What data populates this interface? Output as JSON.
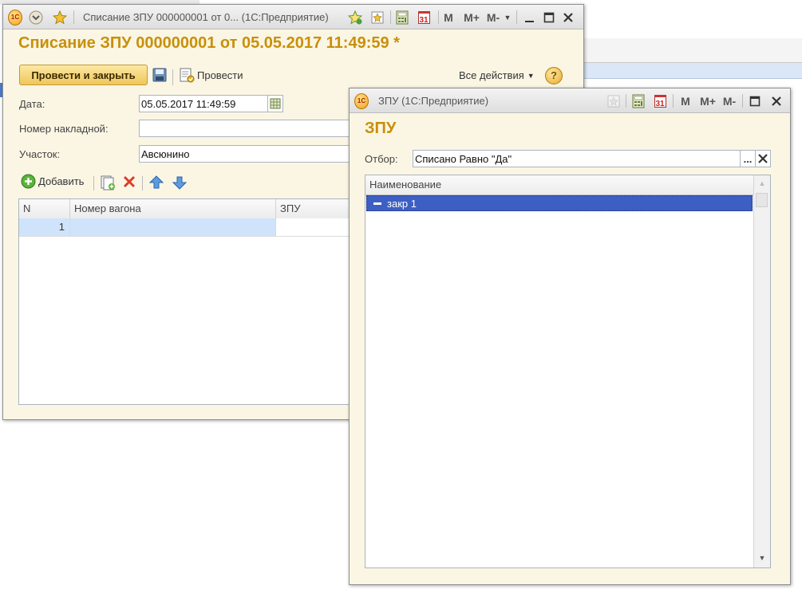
{
  "doc_window": {
    "title": "Списание ЗПУ 000000001 от 0... (1С:Предприятие)",
    "form_title": "Списание ЗПУ 000000001 от 05.05.2017 11:49:59 *",
    "post_close_label": "Провести и закрыть",
    "post_label": "Провести",
    "all_actions_label": "Все действия",
    "help_label": "?",
    "date_label": "Дата:",
    "date_value": "05.05.2017 11:49:59",
    "invoice_label": "Номер накладной:",
    "invoice_value": "",
    "section_label": "Участок:",
    "section_value": "Авсюнино",
    "add_label": "Добавить",
    "columns": [
      "N",
      "Номер вагона",
      "ЗПУ"
    ],
    "rows": [
      {
        "n": "1",
        "wagon": "",
        "zpu": ""
      }
    ]
  },
  "choice_window": {
    "title": "ЗПУ (1С:Предприятие)",
    "form_title": "ЗПУ",
    "filter_label": "Отбор:",
    "filter_value": "Списано Равно \"Да\"",
    "filter_more_label": "...",
    "column_name": "Наименование",
    "items": [
      {
        "label": "закр 1"
      }
    ]
  },
  "toolbar_text": {
    "m": "M",
    "m_plus": "M+",
    "m_minus": "M-",
    "calendar_day": "31",
    "logo": "1С"
  },
  "icons": {
    "logo": "1c-logo-icon",
    "menu": "menu-icon",
    "favorite": "star-icon",
    "calc": "calculator-icon",
    "calendar": "calendar-icon",
    "save": "save-icon",
    "post": "post-doc-icon",
    "add": "add-icon",
    "copy": "copy-icon",
    "delete": "delete-icon",
    "up": "arrow-up-icon",
    "down": "arrow-down-icon"
  },
  "colors": {
    "title_accent": "#c8900a",
    "form_bg": "#fbf6e4",
    "selection": "#3d5fc4",
    "grid_selection": "#cfe4fb"
  }
}
